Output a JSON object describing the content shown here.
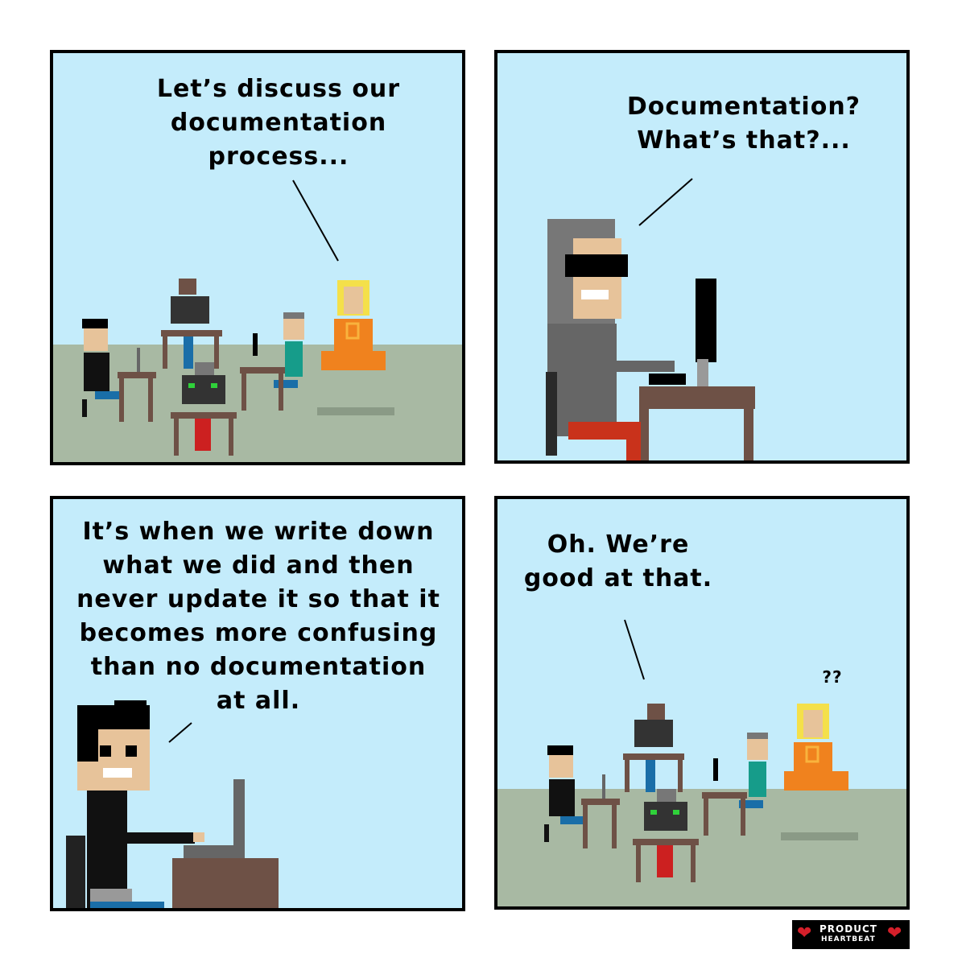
{
  "comic": {
    "panel1": {
      "speech": "Let’s discuss our\ndocumentation\nprocess..."
    },
    "panel2": {
      "speech": "Documentation?\nWhat’s that?..."
    },
    "panel3": {
      "speech": "It’s when we write down\nwhat we did and then\nnever update it so that it\nbecomes more confusing\nthan no documentation\nat all."
    },
    "panel4": {
      "speech": "Oh. We’re\ngood at that.",
      "thought": "??"
    }
  },
  "logo": {
    "line1": "PRODUCT",
    "line2": "HEARTBEAT",
    "heart_color": "#d41f2a"
  },
  "colors": {
    "sky": "#c4ecfb",
    "floor": "#a8b9a3",
    "desk": "#6e5146",
    "orange": "#f0821e"
  }
}
